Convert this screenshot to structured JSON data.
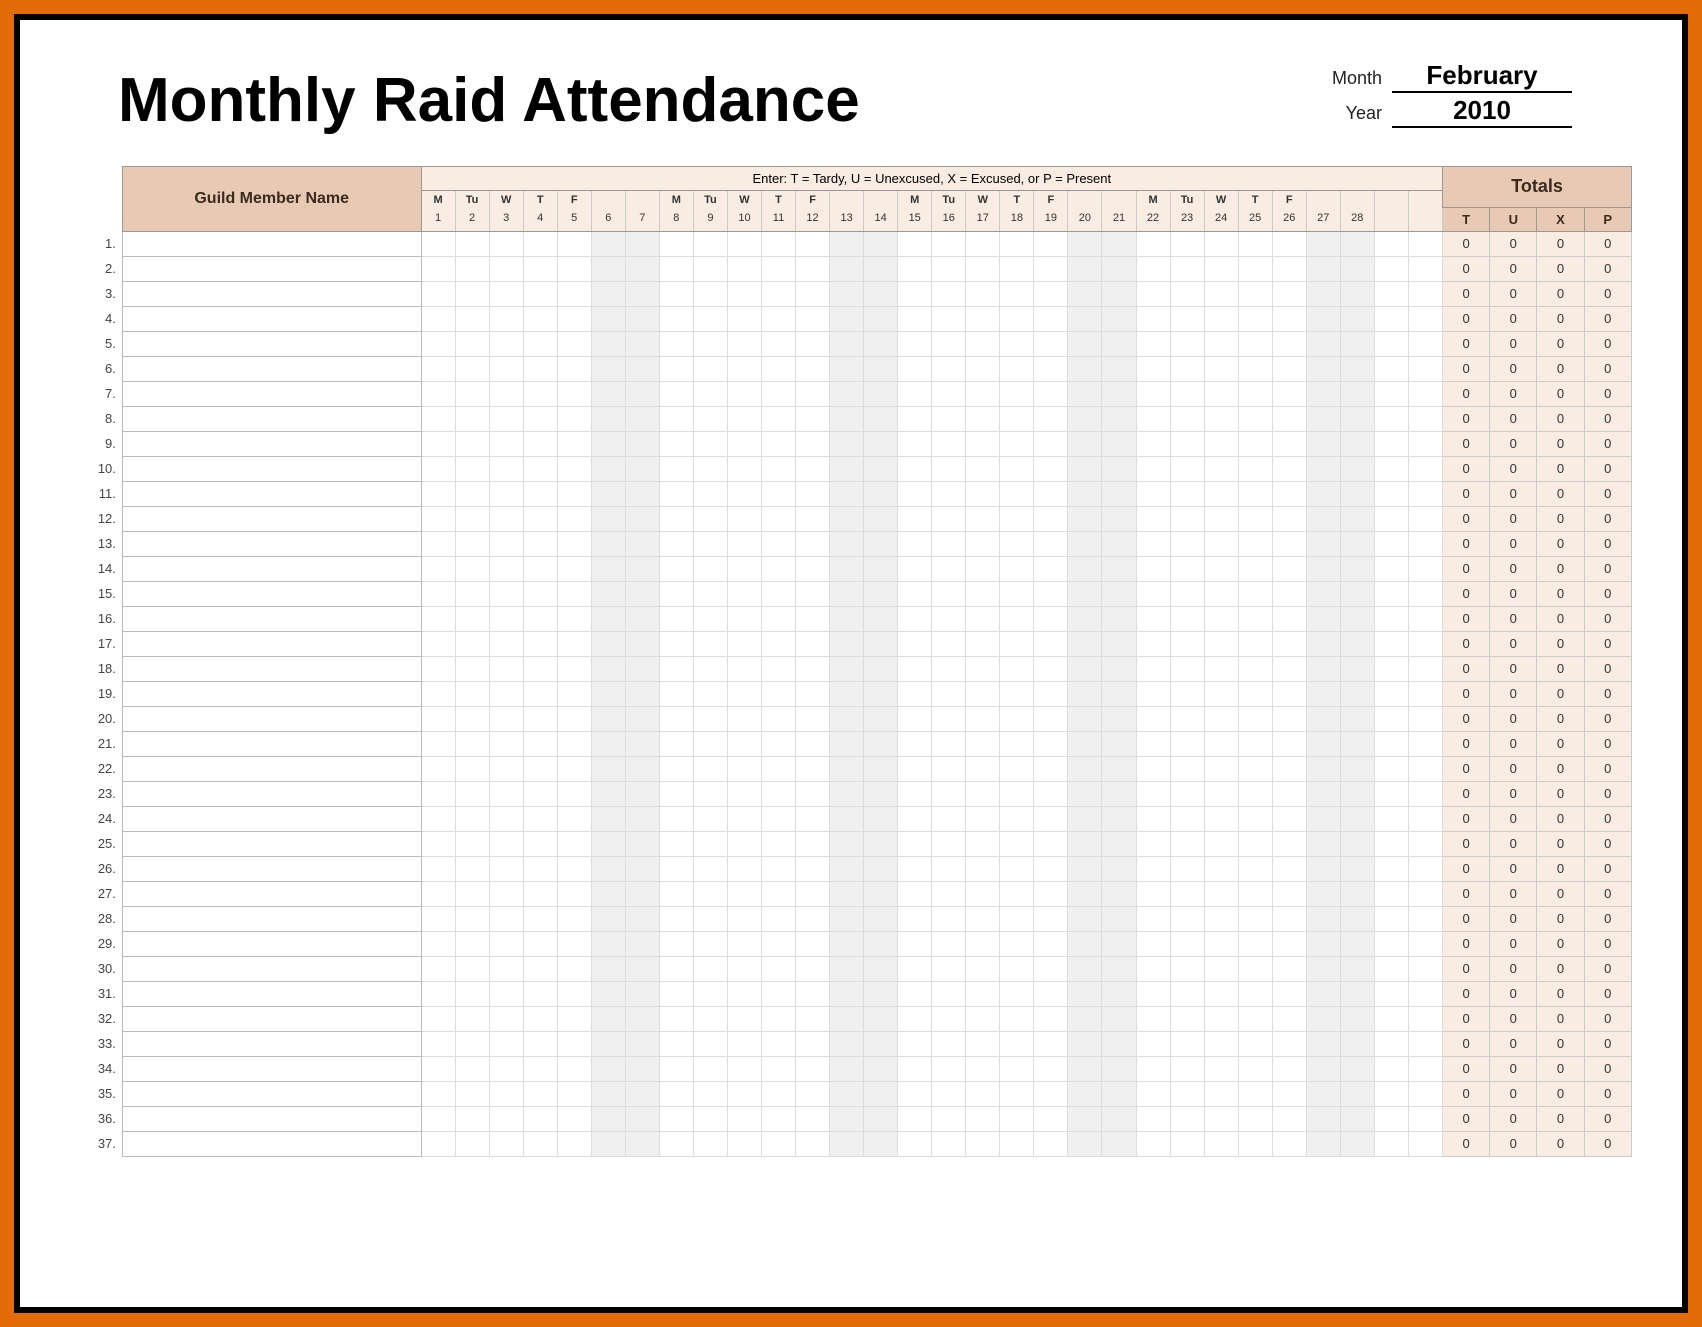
{
  "title": "Monthly Raid Attendance",
  "meta": {
    "month_label": "Month",
    "month_value": "February",
    "year_label": "Year",
    "year_value": "2010"
  },
  "legend_text": "Enter: T = Tardy,  U = Unexcused,  X = Excused,  or P = Present",
  "name_header": "Guild Member Name",
  "totals_header": "Totals",
  "total_codes": [
    "T",
    "U",
    "X",
    "P"
  ],
  "days": [
    {
      "n": 1,
      "w": "M",
      "weekend": false
    },
    {
      "n": 2,
      "w": "Tu",
      "weekend": false
    },
    {
      "n": 3,
      "w": "W",
      "weekend": false
    },
    {
      "n": 4,
      "w": "T",
      "weekend": false
    },
    {
      "n": 5,
      "w": "F",
      "weekend": false
    },
    {
      "n": 6,
      "w": "",
      "weekend": true
    },
    {
      "n": 7,
      "w": "",
      "weekend": true
    },
    {
      "n": 8,
      "w": "M",
      "weekend": false
    },
    {
      "n": 9,
      "w": "Tu",
      "weekend": false
    },
    {
      "n": 10,
      "w": "W",
      "weekend": false
    },
    {
      "n": 11,
      "w": "T",
      "weekend": false
    },
    {
      "n": 12,
      "w": "F",
      "weekend": false
    },
    {
      "n": 13,
      "w": "",
      "weekend": true
    },
    {
      "n": 14,
      "w": "",
      "weekend": true
    },
    {
      "n": 15,
      "w": "M",
      "weekend": false
    },
    {
      "n": 16,
      "w": "Tu",
      "weekend": false
    },
    {
      "n": 17,
      "w": "W",
      "weekend": false
    },
    {
      "n": 18,
      "w": "T",
      "weekend": false
    },
    {
      "n": 19,
      "w": "F",
      "weekend": false
    },
    {
      "n": 20,
      "w": "",
      "weekend": true
    },
    {
      "n": 21,
      "w": "",
      "weekend": true
    },
    {
      "n": 22,
      "w": "M",
      "weekend": false
    },
    {
      "n": 23,
      "w": "Tu",
      "weekend": false
    },
    {
      "n": 24,
      "w": "W",
      "weekend": false
    },
    {
      "n": 25,
      "w": "T",
      "weekend": false
    },
    {
      "n": 26,
      "w": "F",
      "weekend": false
    },
    {
      "n": 27,
      "w": "",
      "weekend": true
    },
    {
      "n": 28,
      "w": "",
      "weekend": true
    },
    {
      "n": "",
      "w": "",
      "weekend": false
    },
    {
      "n": "",
      "w": "",
      "weekend": false
    }
  ],
  "rows": [
    {
      "num": "1.",
      "name": "",
      "marks": [],
      "totals": [
        0,
        0,
        0,
        0
      ]
    },
    {
      "num": "2.",
      "name": "",
      "marks": [],
      "totals": [
        0,
        0,
        0,
        0
      ]
    },
    {
      "num": "3.",
      "name": "",
      "marks": [],
      "totals": [
        0,
        0,
        0,
        0
      ]
    },
    {
      "num": "4.",
      "name": "",
      "marks": [],
      "totals": [
        0,
        0,
        0,
        0
      ]
    },
    {
      "num": "5.",
      "name": "",
      "marks": [],
      "totals": [
        0,
        0,
        0,
        0
      ]
    },
    {
      "num": "6.",
      "name": "",
      "marks": [],
      "totals": [
        0,
        0,
        0,
        0
      ]
    },
    {
      "num": "7.",
      "name": "",
      "marks": [],
      "totals": [
        0,
        0,
        0,
        0
      ]
    },
    {
      "num": "8.",
      "name": "",
      "marks": [],
      "totals": [
        0,
        0,
        0,
        0
      ]
    },
    {
      "num": "9.",
      "name": "",
      "marks": [],
      "totals": [
        0,
        0,
        0,
        0
      ]
    },
    {
      "num": "10.",
      "name": "",
      "marks": [],
      "totals": [
        0,
        0,
        0,
        0
      ]
    },
    {
      "num": "11.",
      "name": "",
      "marks": [],
      "totals": [
        0,
        0,
        0,
        0
      ]
    },
    {
      "num": "12.",
      "name": "",
      "marks": [],
      "totals": [
        0,
        0,
        0,
        0
      ]
    },
    {
      "num": "13.",
      "name": "",
      "marks": [],
      "totals": [
        0,
        0,
        0,
        0
      ]
    },
    {
      "num": "14.",
      "name": "",
      "marks": [],
      "totals": [
        0,
        0,
        0,
        0
      ]
    },
    {
      "num": "15.",
      "name": "",
      "marks": [],
      "totals": [
        0,
        0,
        0,
        0
      ]
    },
    {
      "num": "16.",
      "name": "",
      "marks": [],
      "totals": [
        0,
        0,
        0,
        0
      ]
    },
    {
      "num": "17.",
      "name": "",
      "marks": [],
      "totals": [
        0,
        0,
        0,
        0
      ]
    },
    {
      "num": "18.",
      "name": "",
      "marks": [],
      "totals": [
        0,
        0,
        0,
        0
      ]
    },
    {
      "num": "19.",
      "name": "",
      "marks": [],
      "totals": [
        0,
        0,
        0,
        0
      ]
    },
    {
      "num": "20.",
      "name": "",
      "marks": [],
      "totals": [
        0,
        0,
        0,
        0
      ]
    },
    {
      "num": "21.",
      "name": "",
      "marks": [],
      "totals": [
        0,
        0,
        0,
        0
      ]
    },
    {
      "num": "22.",
      "name": "",
      "marks": [],
      "totals": [
        0,
        0,
        0,
        0
      ]
    },
    {
      "num": "23.",
      "name": "",
      "marks": [],
      "totals": [
        0,
        0,
        0,
        0
      ]
    },
    {
      "num": "24.",
      "name": "",
      "marks": [],
      "totals": [
        0,
        0,
        0,
        0
      ]
    },
    {
      "num": "25.",
      "name": "",
      "marks": [],
      "totals": [
        0,
        0,
        0,
        0
      ]
    },
    {
      "num": "26.",
      "name": "",
      "marks": [],
      "totals": [
        0,
        0,
        0,
        0
      ]
    },
    {
      "num": "27.",
      "name": "",
      "marks": [],
      "totals": [
        0,
        0,
        0,
        0
      ]
    },
    {
      "num": "28.",
      "name": "",
      "marks": [],
      "totals": [
        0,
        0,
        0,
        0
      ]
    },
    {
      "num": "29.",
      "name": "",
      "marks": [],
      "totals": [
        0,
        0,
        0,
        0
      ]
    },
    {
      "num": "30.",
      "name": "",
      "marks": [],
      "totals": [
        0,
        0,
        0,
        0
      ]
    },
    {
      "num": "31.",
      "name": "",
      "marks": [],
      "totals": [
        0,
        0,
        0,
        0
      ]
    },
    {
      "num": "32.",
      "name": "",
      "marks": [],
      "totals": [
        0,
        0,
        0,
        0
      ]
    },
    {
      "num": "33.",
      "name": "",
      "marks": [],
      "totals": [
        0,
        0,
        0,
        0
      ]
    },
    {
      "num": "34.",
      "name": "",
      "marks": [],
      "totals": [
        0,
        0,
        0,
        0
      ]
    },
    {
      "num": "35.",
      "name": "",
      "marks": [],
      "totals": [
        0,
        0,
        0,
        0
      ]
    },
    {
      "num": "36.",
      "name": "",
      "marks": [],
      "totals": [
        0,
        0,
        0,
        0
      ]
    },
    {
      "num": "37.",
      "name": "",
      "marks": [],
      "totals": [
        0,
        0,
        0,
        0
      ]
    }
  ]
}
